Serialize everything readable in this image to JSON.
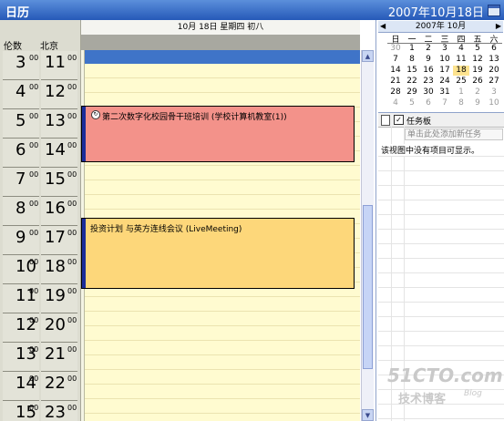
{
  "titlebar": {
    "title": "日历",
    "date": "2007年10月18日"
  },
  "ruler": {
    "labels": [
      "伦数",
      "北京"
    ],
    "rows": [
      {
        "h1": "3",
        "h2": "11"
      },
      {
        "h1": "4",
        "h2": "12"
      },
      {
        "h1": "5",
        "h2": "13"
      },
      {
        "h1": "6",
        "h2": "14"
      },
      {
        "h1": "7",
        "h2": "15"
      },
      {
        "h1": "8",
        "h2": "16"
      },
      {
        "h1": "9",
        "h2": "17"
      },
      {
        "h1": "10",
        "h2": "18"
      },
      {
        "h1": "11",
        "h2": "19"
      },
      {
        "h1": "12",
        "h2": "20"
      },
      {
        "h1": "13",
        "h2": "21"
      },
      {
        "h1": "14",
        "h2": "22"
      },
      {
        "h1": "15",
        "h2": "23"
      }
    ],
    "minutes": "00"
  },
  "day": {
    "header": "10月 18日 星期四 初八"
  },
  "appointments": [
    {
      "text": "第二次数字化校园骨干班培训 (学校计算机教室(1))"
    },
    {
      "text": "投资计划 与英方连线会议 (LiveMeeting)"
    }
  ],
  "minical": {
    "title": "2007年 10月",
    "weekdays": [
      "日",
      "一",
      "二",
      "三",
      "四",
      "五",
      "六"
    ],
    "weeks": [
      [
        "30",
        "1",
        "2",
        "3",
        "4",
        "5",
        "6"
      ],
      [
        "7",
        "8",
        "9",
        "10",
        "11",
        "12",
        "13"
      ],
      [
        "14",
        "15",
        "16",
        "17",
        "18",
        "19",
        "20"
      ],
      [
        "21",
        "22",
        "23",
        "24",
        "25",
        "26",
        "27"
      ],
      [
        "28",
        "29",
        "30",
        "31",
        "1",
        "2",
        "3"
      ],
      [
        "4",
        "5",
        "6",
        "7",
        "8",
        "9",
        "10"
      ]
    ],
    "selected": "18"
  },
  "tasks": {
    "title": "任务板",
    "add_placeholder": "单击此处添加新任务",
    "empty_message": "该视图中没有项目可显示。"
  },
  "watermark": {
    "line1": "51CTO.com",
    "line2": "技术博客",
    "line3": "Blog"
  }
}
